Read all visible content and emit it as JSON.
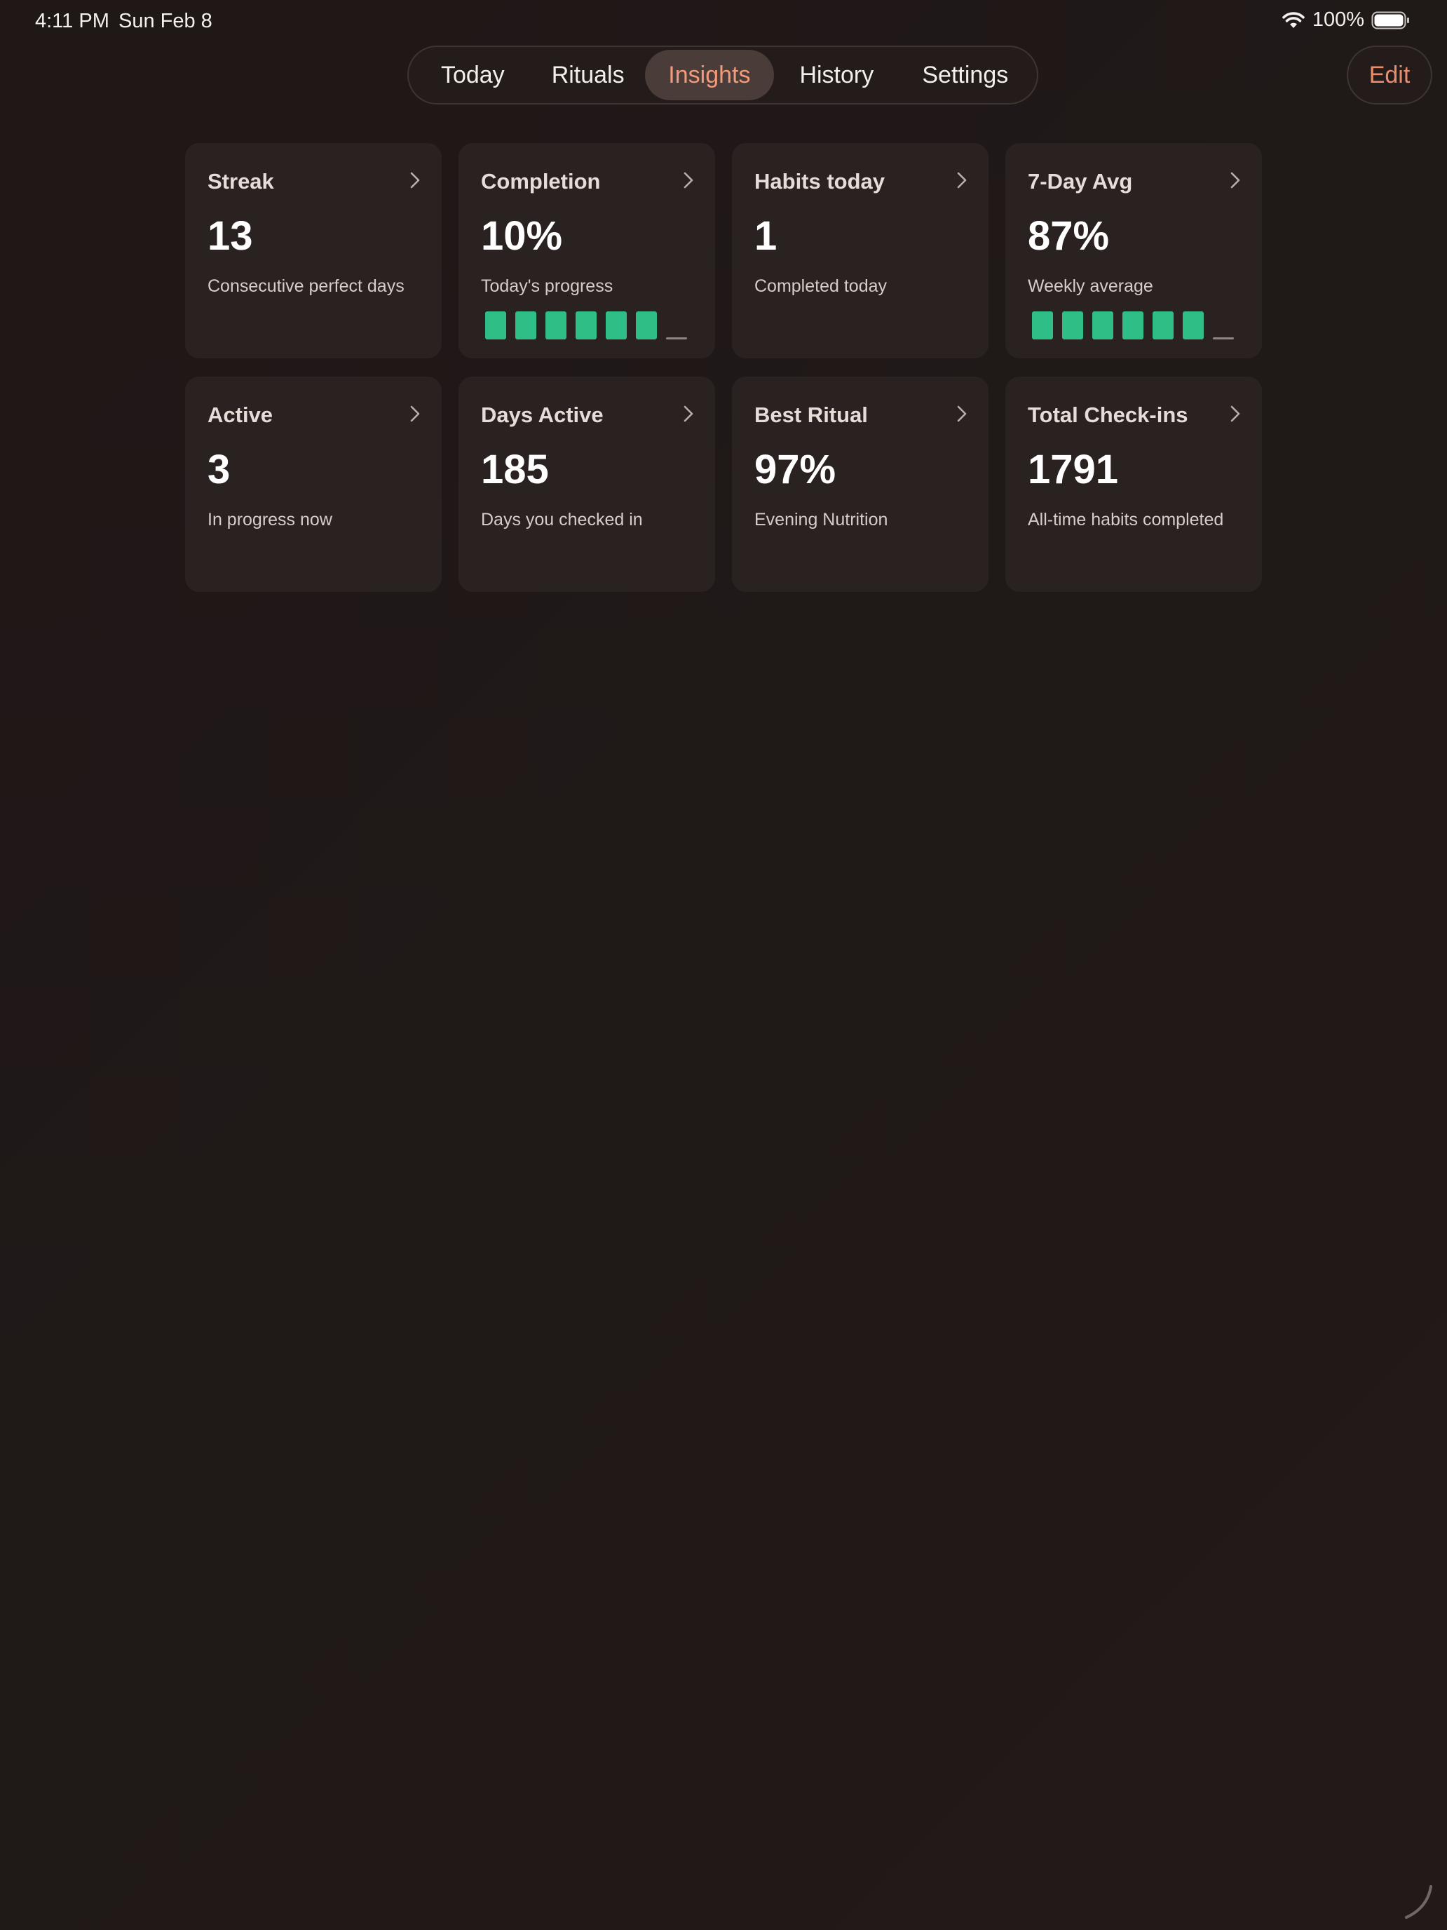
{
  "status_bar": {
    "time": "4:11 PM",
    "date": "Sun Feb 8",
    "battery": "100%",
    "icons": [
      "wifi-icon",
      "battery-icon"
    ]
  },
  "tabs": [
    {
      "label": "Today"
    },
    {
      "label": "Rituals"
    },
    {
      "label": "Insights",
      "active": true
    },
    {
      "label": "History"
    },
    {
      "label": "Settings"
    }
  ],
  "edit_label": "Edit",
  "accent_color": "#f29a7a",
  "success_color": "#2fbf86",
  "cards": [
    {
      "title": "Streak",
      "value": "13",
      "subtitle": "Consecutive perfect days"
    },
    {
      "title": "Completion",
      "value": "10%",
      "subtitle": "Today's progress",
      "bars": [
        1,
        1,
        1,
        1,
        1,
        1,
        0
      ]
    },
    {
      "title": "Habits today",
      "value": "1",
      "subtitle": "Completed today"
    },
    {
      "title": "7-Day Avg",
      "value": "87%",
      "subtitle": "Weekly average",
      "bars": [
        1,
        1,
        1,
        1,
        1,
        1,
        0
      ]
    },
    {
      "title": "Active",
      "value": "3",
      "subtitle": "In progress now"
    },
    {
      "title": "Days Active",
      "value": "185",
      "subtitle": "Days you checked in"
    },
    {
      "title": "Best Ritual",
      "value": "97%",
      "subtitle": "Evening Nutrition"
    },
    {
      "title": "Total Check-ins",
      "value": "1791",
      "subtitle": "All-time habits completed"
    }
  ]
}
